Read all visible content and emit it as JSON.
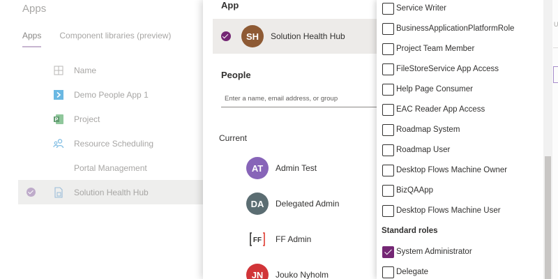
{
  "background": {
    "title": "Apps",
    "tabs": [
      {
        "label": "Apps",
        "active": true
      },
      {
        "label": "Component libraries (preview)",
        "active": false
      }
    ],
    "table": {
      "name_header": "Name",
      "rows": [
        {
          "name": "Demo People App 1",
          "icon": "canvas-app-icon",
          "selected": false
        },
        {
          "name": "Project",
          "icon": "project-icon",
          "selected": false
        },
        {
          "name": "Resource Scheduling",
          "icon": "resource-icon",
          "selected": false
        },
        {
          "name": "Portal Management",
          "icon": "",
          "selected": false
        },
        {
          "name": "Solution Health Hub",
          "icon": "model-app-icon",
          "selected": true
        }
      ]
    },
    "right_edge_text": "U"
  },
  "panel": {
    "app_heading": "App",
    "selected_app": {
      "initials": "SH",
      "name": "Solution Health Hub",
      "avatar_color": "#8e5a34"
    },
    "people_heading": "People",
    "people_placeholder": "Enter a name, email address, or group",
    "current_heading": "Current",
    "current_people": [
      {
        "initials": "AT",
        "name": "Admin Test",
        "avatar_color": "#8764b8",
        "type": "avatar"
      },
      {
        "initials": "DA",
        "name": "Delegated Admin",
        "avatar_color": "#5b6d72",
        "type": "avatar"
      },
      {
        "initials": "FF",
        "name": "FF Admin",
        "avatar_color": "#ffffff",
        "type": "logo"
      },
      {
        "initials": "JN",
        "name": "Jouko Nyholm",
        "avatar_color": "#d13438",
        "type": "avatar"
      }
    ]
  },
  "roles": {
    "items": [
      {
        "label": "Service Writer",
        "checked": false
      },
      {
        "label": "BusinessApplicationPlatformRole",
        "checked": false
      },
      {
        "label": "Project Team Member",
        "checked": false
      },
      {
        "label": "FileStoreService App Access",
        "checked": false
      },
      {
        "label": "Help Page Consumer",
        "checked": false
      },
      {
        "label": "EAC Reader App Access",
        "checked": false
      },
      {
        "label": "Roadmap System",
        "checked": false
      },
      {
        "label": "Roadmap User",
        "checked": false
      },
      {
        "label": "Desktop Flows Machine Owner",
        "checked": false
      },
      {
        "label": "BizQAApp",
        "checked": false
      },
      {
        "label": "Desktop Flows Machine User",
        "checked": false
      }
    ],
    "standard_heading": "Standard roles",
    "standard_items": [
      {
        "label": "System Administrator",
        "checked": true
      },
      {
        "label": "Delegate",
        "checked": false
      }
    ]
  },
  "colors": {
    "accent": "#742774",
    "selected_row": "#edebe9"
  }
}
